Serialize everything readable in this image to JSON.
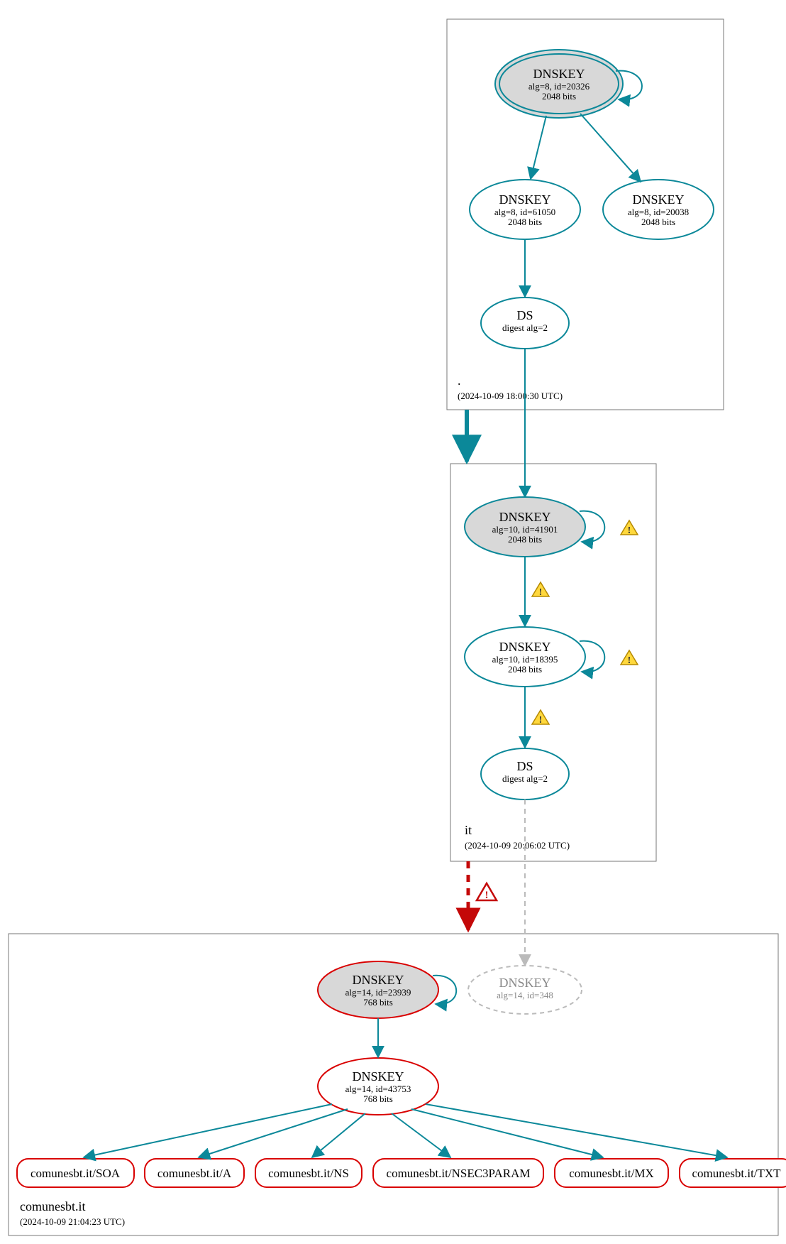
{
  "colors": {
    "teal": "#0b8899",
    "red": "#d90000",
    "gray": "#bababa",
    "nodeFill": "#d8d8d8"
  },
  "zones": {
    "root": {
      "label": ".",
      "time": "(2024-10-09 18:00:30 UTC)"
    },
    "it": {
      "label": "it",
      "time": "(2024-10-09 20:06:02 UTC)"
    },
    "domain": {
      "label": "comunesbt.it",
      "time": "(2024-10-09 21:04:23 UTC)"
    }
  },
  "nodes": {
    "root_ksk": {
      "t": "DNSKEY",
      "l1": "alg=8, id=20326",
      "l2": "2048 bits"
    },
    "root_zsk1": {
      "t": "DNSKEY",
      "l1": "alg=8, id=61050",
      "l2": "2048 bits"
    },
    "root_zsk2": {
      "t": "DNSKEY",
      "l1": "alg=8, id=20038",
      "l2": "2048 bits"
    },
    "root_ds": {
      "t": "DS",
      "l1": "digest alg=2",
      "l2": ""
    },
    "it_ksk": {
      "t": "DNSKEY",
      "l1": "alg=10, id=41901",
      "l2": "2048 bits"
    },
    "it_zsk": {
      "t": "DNSKEY",
      "l1": "alg=10, id=18395",
      "l2": "2048 bits"
    },
    "it_ds": {
      "t": "DS",
      "l1": "digest alg=2",
      "l2": ""
    },
    "dom_ksk": {
      "t": "DNSKEY",
      "l1": "alg=14, id=23939",
      "l2": "768 bits"
    },
    "dom_ghost": {
      "t": "DNSKEY",
      "l1": "alg=14, id=348",
      "l2": ""
    },
    "dom_zsk": {
      "t": "DNSKEY",
      "l1": "alg=14, id=43753",
      "l2": "768 bits"
    }
  },
  "rr": {
    "soa": "comunesbt.it/SOA",
    "a": "comunesbt.it/A",
    "ns": "comunesbt.it/NS",
    "nsec3": "comunesbt.it/NSEC3PARAM",
    "mx": "comunesbt.it/MX",
    "txt": "comunesbt.it/TXT"
  }
}
